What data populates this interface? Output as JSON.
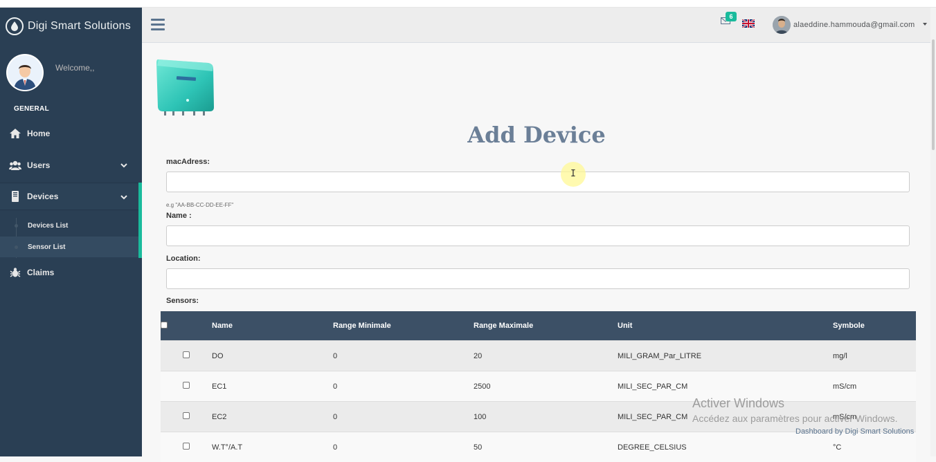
{
  "brand": {
    "title": "Digi Smart Solutions"
  },
  "sidebar": {
    "welcome": "Welcome,,",
    "section": "GENERAL",
    "items": [
      {
        "label": "Home",
        "icon": "home-icon"
      },
      {
        "label": "Users",
        "icon": "users-icon"
      },
      {
        "label": "Devices",
        "icon": "devices-icon"
      },
      {
        "label": "Claims",
        "icon": "bug-icon"
      }
    ],
    "subitems": [
      {
        "label": "Devices List"
      },
      {
        "label": "Sensor List"
      }
    ]
  },
  "topbar": {
    "mail_count": "6",
    "user_email": "alaeddine.hammouda@gmail.com"
  },
  "page": {
    "title": "Add Device",
    "mac_label": "macAdress:",
    "mac_value": "",
    "mac_hint": "e.g \"AA-BB-CC-DD-EE-FF\"",
    "name_label": "Name :",
    "name_value": "",
    "location_label": "Location:",
    "location_value": "",
    "sensors_label": "Sensors:"
  },
  "table": {
    "headers": [
      "Name",
      "Range Minimale",
      "Range Maximale",
      "Unit",
      "Symbole"
    ],
    "rows": [
      [
        "DO",
        "0",
        "20",
        "MILI_GRAM_Par_LITRE",
        "mg/l"
      ],
      [
        "EC1",
        "0",
        "2500",
        "MILI_SEC_PAR_CM",
        "mS/cm"
      ],
      [
        "EC2",
        "0",
        "100",
        "MILI_SEC_PAR_CM",
        "mS/cm"
      ],
      [
        "W.T°/A.T",
        "0",
        "50",
        "DEGREE_CELSIUS",
        "°C"
      ]
    ]
  },
  "watermark": {
    "line1": "Activer Windows",
    "line2": "Accédez aux paramètres pour activer Windows."
  },
  "footer": {
    "text": "Dashboard by Digi Smart Solutions"
  },
  "colors": {
    "sidebar": "#2a3f54",
    "accent": "#1abb9c",
    "title": "#6b7f97",
    "table_header": "#3c5066"
  }
}
